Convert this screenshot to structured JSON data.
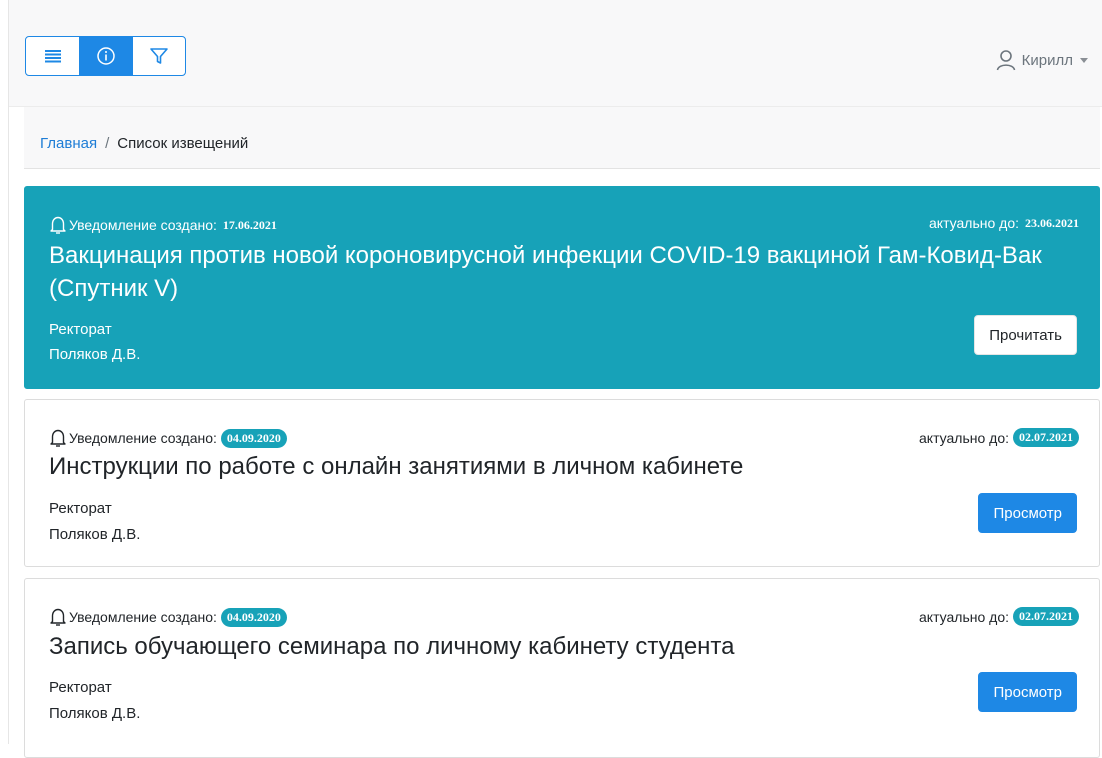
{
  "header": {
    "buttons": [
      {
        "icon": "menu-icon"
      },
      {
        "icon": "info-icon"
      },
      {
        "icon": "filter-icon"
      }
    ],
    "user_name": "Кирилл"
  },
  "breadcrumb": {
    "home": "Главная",
    "separator": "/",
    "current": "Список извещений"
  },
  "notifications": [
    {
      "created_label": "Уведомление создано:",
      "created_date": "17.06.2021",
      "valid_label": "актуально до:",
      "valid_date": "23.06.2021",
      "title": "Вакцинация против новой короновирусной инфекции COVID-19 вакциной Гам-Ковид-Вак (Спутник V)",
      "department": "Ректорат",
      "author": "Поляков Д.В.",
      "action": "Прочитать",
      "highlighted": true
    },
    {
      "created_label": "Уведомление создано:",
      "created_date": "04.09.2020",
      "valid_label": "актуально до:",
      "valid_date": "02.07.2021",
      "title": "Инструкции по работе с онлайн занятиями в личном кабинете",
      "department": "Ректорат",
      "author": "Поляков Д.В.",
      "action": "Просмотр",
      "highlighted": false
    },
    {
      "created_label": "Уведомление создано:",
      "created_date": "04.09.2020",
      "valid_label": "актуально до:",
      "valid_date": "02.07.2021",
      "title": "Запись обучающего семинара по личному кабинету студента",
      "department": "Ректорат",
      "author": "Поляков Д.В.",
      "action": "Просмотр",
      "highlighted": false
    }
  ],
  "colors": {
    "accent": "#1e88e5",
    "highlight": "#17a2b8",
    "link": "#1e7dd6"
  }
}
